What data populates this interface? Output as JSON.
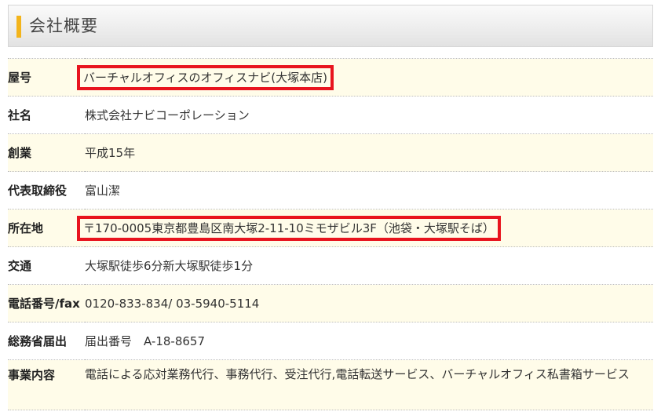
{
  "section": {
    "title": "会社概要"
  },
  "rows": [
    {
      "label": "屋号",
      "value": "バーチャルオフィスのオフィスナビ(大塚本店)",
      "highlighted": true
    },
    {
      "label": "社名",
      "value": "株式会社ナビコーポレーション",
      "highlighted": false
    },
    {
      "label": "創業",
      "value": "平成15年",
      "highlighted": false
    },
    {
      "label": "代表取締役",
      "value": "富山潔",
      "highlighted": false
    },
    {
      "label": "所在地",
      "value": "〒170-0005東京都豊島区南大塚2-11-10ミモザビル3F（池袋・大塚駅そば）",
      "highlighted": true
    },
    {
      "label": "交通",
      "value": "大塚駅徒歩6分新大塚駅徒歩1分",
      "highlighted": false
    },
    {
      "label": "電話番号/fax",
      "value": "0120-833-834/ 03-5940-5114",
      "highlighted": false
    },
    {
      "label": "総務省届出",
      "value": "届出番号　A-18-8657",
      "highlighted": false
    },
    {
      "label": "事業内容",
      "value": "電話による応対業務代行、事務代行、受注代行,電話転送サービス、バーチャルオフィス私書箱サービス",
      "highlighted": false
    }
  ],
  "colors": {
    "highlight_border": "#e8141e",
    "odd_row_bg": "#fffce9",
    "accent_bar": "#f3b41b"
  }
}
